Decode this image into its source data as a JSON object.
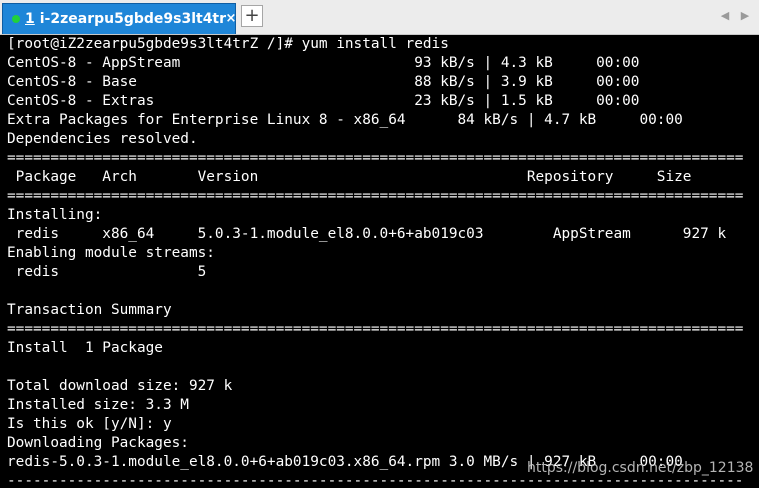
{
  "tab": {
    "index": "1",
    "title": "i-2zearpu5gbde9s3lt4tr",
    "status_color": "#21d13b",
    "close_icon": "×",
    "add_label": "+"
  },
  "nav": {
    "prev_icon": "◀",
    "next_icon": "▶"
  },
  "terminal": {
    "lines": [
      "[root@iZ2zearpu5gbde9s3lt4trZ /]# yum install redis",
      "CentOS-8 - AppStream                           93 kB/s | 4.3 kB     00:00",
      "CentOS-8 - Base                                88 kB/s | 3.9 kB     00:00",
      "CentOS-8 - Extras                              23 kB/s | 1.5 kB     00:00",
      "Extra Packages for Enterprise Linux 8 - x86_64      84 kB/s | 4.7 kB     00:00",
      "Dependencies resolved.",
      "=====================================================================================",
      " Package   Arch       Version                               Repository     Size",
      "=====================================================================================",
      "Installing:",
      " redis     x86_64     5.0.3-1.module_el8.0.0+6+ab019c03        AppStream      927 k",
      "Enabling module streams:",
      " redis                5",
      "",
      "Transaction Summary",
      "=====================================================================================",
      "Install  1 Package",
      "",
      "Total download size: 927 k",
      "Installed size: 3.3 M",
      "Is this ok [y/N]: y",
      "Downloading Packages:",
      "redis-5.0.3-1.module_el8.0.0+6+ab019c03.x86_64.rpm 3.0 MB/s | 927 kB     00:00",
      "-------------------------------------------------------------------------------------"
    ]
  },
  "watermark": "https://blog.csdn.net/zbp_12138"
}
